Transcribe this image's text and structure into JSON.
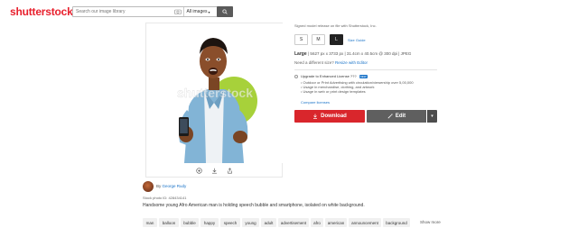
{
  "header": {
    "logo": "shutterstock",
    "search_placeholder": "Search our image library",
    "all_images": "All images"
  },
  "photo": {
    "watermark": "shutterstock"
  },
  "toolbar_icons": [
    "zoom-in-icon",
    "download-icon",
    "share-icon"
  ],
  "sidebar": {
    "release_note": "Signed model release on file with Shutterstock, Inc.",
    "sizes": [
      "S",
      "M",
      "L"
    ],
    "selected_size": "L",
    "size_guide": "Size Guide",
    "size_name": "Large",
    "size_details": "| 5627 px x 3733 px | 31.4cm x 40.5cm @ 300 dpi | JPEG",
    "different_size": "Need a different size?",
    "resize_link": "Resize with Editor",
    "upgrade_label": "Upgrade to Enhanced License ???",
    "upgrade_badge": "NEW",
    "bullets": [
      "Outdoor or Print Advertising with circulation/viewership over 5,00,000",
      "Usage in merchandise, clothing, and artwork",
      "Usage in web or print design templates"
    ],
    "compare_link": "Compare licenses",
    "download_label": "Download",
    "edit_label": "Edit"
  },
  "author": {
    "by": "By",
    "name": "George Rudy",
    "photo_id": "Stock photo ID: 428434141",
    "description": "Handsome young Afro American man is holding speech bubble and smartphone, isolated on white background."
  },
  "tags": [
    "man",
    "balloon",
    "bubble",
    "happy",
    "speech",
    "young",
    "adult",
    "advertisement",
    "afro",
    "american",
    "announcement",
    "background"
  ],
  "show_more": "Show more",
  "colors": {
    "brand": "#e8202d",
    "download": "#d9262c",
    "edit": "#5f5f5f",
    "link": "#1a73c8"
  }
}
